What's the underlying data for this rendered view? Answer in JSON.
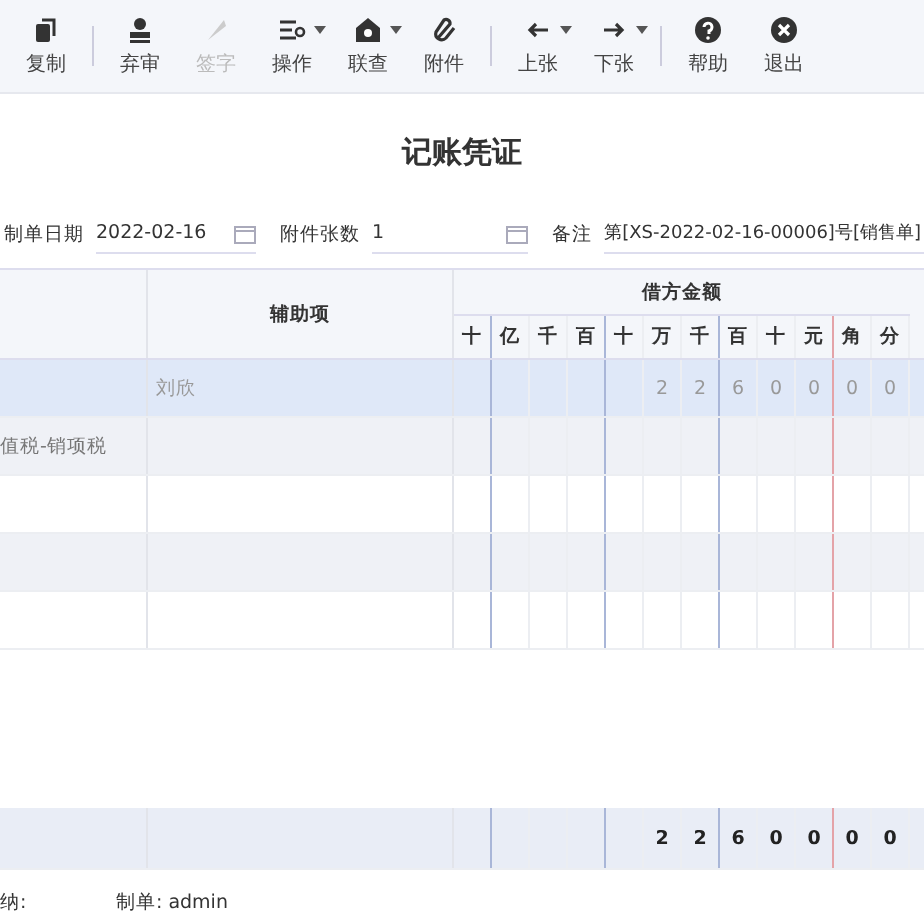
{
  "toolbar_groups": [
    [
      {
        "label": "复制",
        "disabled": false,
        "dropdown": false
      }
    ],
    [
      {
        "label": "弃审",
        "disabled": false,
        "dropdown": false
      },
      {
        "label": "签字",
        "disabled": true,
        "dropdown": false
      },
      {
        "label": "操作",
        "disabled": false,
        "dropdown": true
      },
      {
        "label": "联查",
        "disabled": false,
        "dropdown": true
      },
      {
        "label": "附件",
        "disabled": false,
        "dropdown": false
      }
    ],
    [
      {
        "label": "上张",
        "disabled": false,
        "dropdown": true
      },
      {
        "label": "下张",
        "disabled": false,
        "dropdown": true
      }
    ],
    [
      {
        "label": "帮助",
        "disabled": false,
        "dropdown": false
      },
      {
        "label": "退出",
        "disabled": false,
        "dropdown": false
      }
    ]
  ],
  "title": "记账凭证",
  "form": {
    "date_label": "制单日期",
    "date": "2022-02-16",
    "attachments_label": "附件张数",
    "attachments": "1",
    "remark_label": "备注",
    "remark": "第[XS-2022-02-16-00006]号[销售单]"
  },
  "table": {
    "auxiliary_header": "辅助项",
    "debit_header": "借方金额",
    "digit_units": [
      "十",
      "亿",
      "千",
      "百",
      "十",
      "万",
      "千",
      "百",
      "十",
      "元",
      "角",
      "分"
    ],
    "rows": [
      {
        "selected": true,
        "auxiliary": "刘欣",
        "amount_digits": [
          "2",
          "2",
          "6",
          "0",
          "0",
          "0",
          "0"
        ]
      },
      {
        "selected": false,
        "column_1": "值税-销项税"
      },
      {
        "selected": false
      },
      {
        "selected": false
      },
      {
        "selected": false
      }
    ],
    "total_digits": [
      "2",
      "2",
      "6",
      "0",
      "0",
      "0",
      "0"
    ]
  },
  "footer": {
    "cashier_label": "纳:",
    "maker_label": "制单:",
    "maker": "admin"
  }
}
